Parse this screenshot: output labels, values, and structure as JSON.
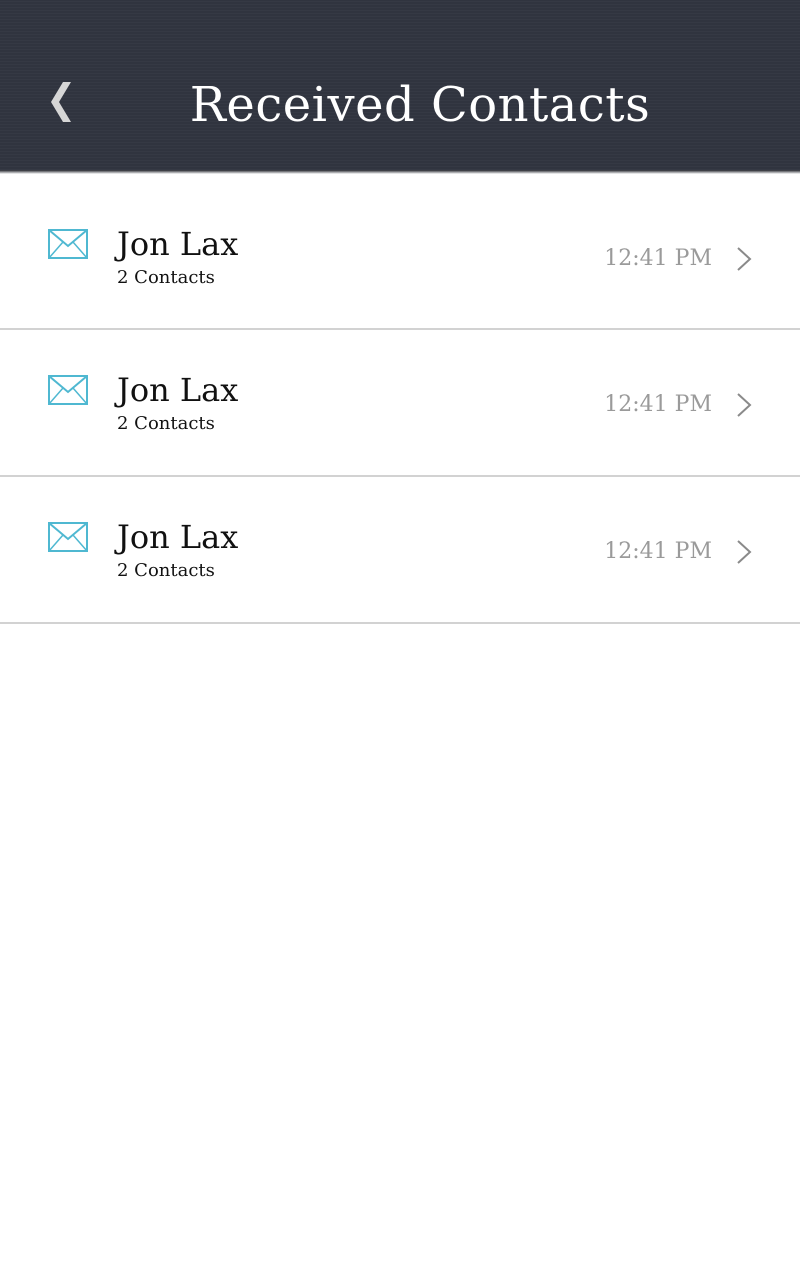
{
  "header": {
    "title": "Received Contacts",
    "back_icon": "back-chevron-icon",
    "background_color": "#30343f"
  },
  "list": {
    "items": [
      {
        "name": "Jon Lax",
        "subtitle": "2 Contacts",
        "time": "12:41 PM",
        "icon": "mail-icon",
        "accent_color": "#4fb8d1"
      },
      {
        "name": "Jon Lax",
        "subtitle": "2 Contacts",
        "time": "12:41 PM",
        "icon": "mail-icon",
        "accent_color": "#4fb8d1"
      },
      {
        "name": "Jon Lax",
        "subtitle": "2 Contacts",
        "time": "12:41 PM",
        "icon": "mail-icon",
        "accent_color": "#4fb8d1"
      }
    ]
  }
}
